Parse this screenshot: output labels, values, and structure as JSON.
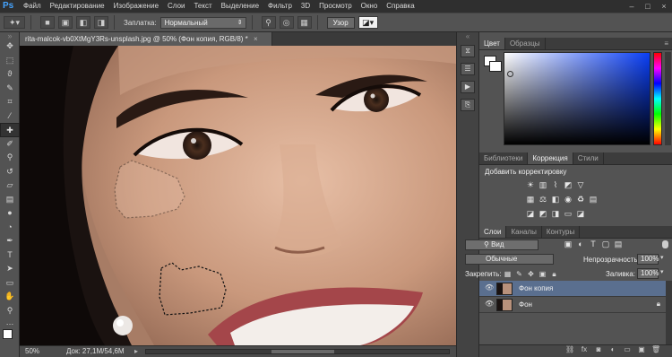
{
  "app": {
    "logo": "Ps"
  },
  "menu": [
    "Файл",
    "Редактирование",
    "Изображение",
    "Слои",
    "Текст",
    "Выделение",
    "Фильтр",
    "3D",
    "Просмотр",
    "Окно",
    "Справка"
  ],
  "options": {
    "label": "Заплатка:",
    "mode": "Нормальный",
    "pattern_button": "Узор"
  },
  "document": {
    "tab_title": "rita-malcok-vb0XtMgY3Rs-unsplash.jpg @ 50% (Фон копия, RGB/8) *",
    "close": "×"
  },
  "status": {
    "zoom": "50%",
    "doc_info": "Док: 27,1M/54,6M"
  },
  "color_panel": {
    "tabs": [
      "Цвет",
      "Образцы"
    ],
    "active": "Цвет"
  },
  "adjustments_panel": {
    "tabs": [
      "Библиотеки",
      "Коррекция",
      "Стили"
    ],
    "active": "Коррекция",
    "title": "Добавить корректировку"
  },
  "layers_panel": {
    "tabs": [
      "Слои",
      "Каналы",
      "Контуры"
    ],
    "active": "Слои",
    "filter_kind": "Вид",
    "blend_mode": "Обычные",
    "opacity_label": "Непрозрачность:",
    "opacity_value": "100%",
    "lock_label": "Закрепить:",
    "fill_label": "Заливка:",
    "fill_value": "100%",
    "layers": [
      {
        "name": "Фон копия",
        "selected": true,
        "locked": false
      },
      {
        "name": "Фон",
        "selected": false,
        "locked": true
      }
    ]
  },
  "colors": {
    "foreground": "#ffffff",
    "background": "#ffffff",
    "picker_hue": "#0a3ef5",
    "selected_layer": "#5a6f8f",
    "panel": "#535353"
  },
  "icons": {
    "tools": [
      "move-icon",
      "marquee-icon",
      "lasso-icon",
      "quick-select-icon",
      "crop-icon",
      "eyedropper-icon",
      "spot-healing-icon",
      "brush-icon",
      "clone-stamp-icon",
      "history-brush-icon",
      "eraser-icon",
      "gradient-icon",
      "blur-icon",
      "dodge-icon",
      "pen-icon",
      "type-icon",
      "path-select-icon",
      "rectangle-icon",
      "hand-icon",
      "zoom-icon"
    ]
  }
}
